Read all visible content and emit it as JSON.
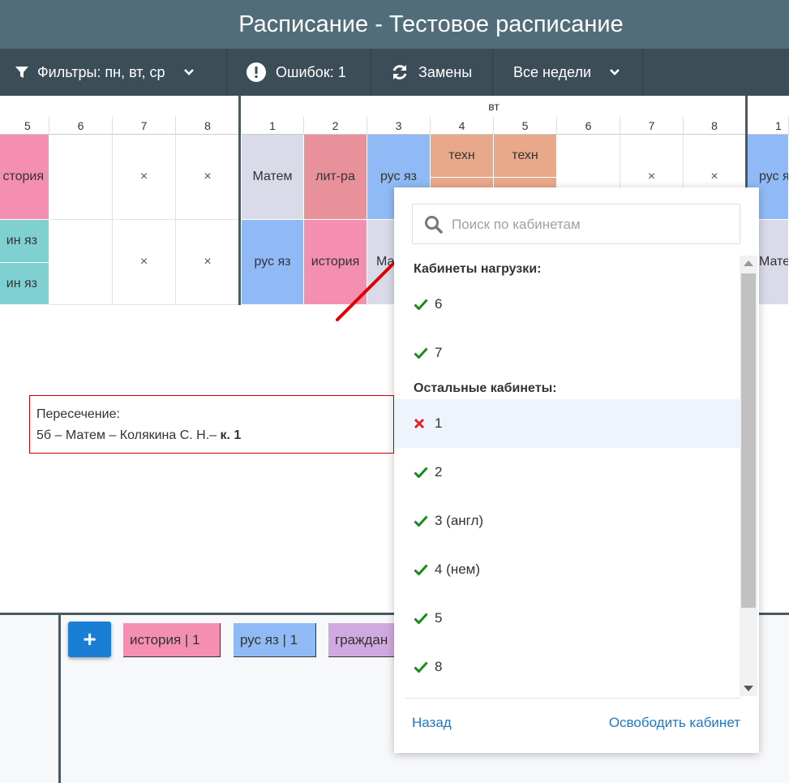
{
  "header": {
    "title": "Расписание - Тестовое расписание"
  },
  "toolbar": {
    "filters_label": "Фильтры: пн, вт, ср",
    "errors_label": "Ошибок: 1",
    "replacements_label": "Замены",
    "weeks_label": "Все недели"
  },
  "grid": {
    "day_label": "вт",
    "left_numbers": [
      "5",
      "6",
      "7",
      "8"
    ],
    "mid_numbers": [
      "1",
      "2",
      "3",
      "4",
      "5",
      "6",
      "7",
      "8"
    ],
    "right_numbers": [
      "1"
    ],
    "row1": {
      "c_left": "стория",
      "c1": "Матем",
      "c2": "лит-ра",
      "c3": "рус яз",
      "c4": "техн",
      "c5": "техн",
      "c_right": "рус яз"
    },
    "row2": {
      "c_left_top": "ин яз",
      "c_left_bottom": "ин яз",
      "c1": "рус яз",
      "c2": "история",
      "c3": "Ма",
      "c_right": "Мате"
    },
    "x_mark": "×",
    "colors": {
      "history": "#f48fb1",
      "russian": "#8fbaf5",
      "math": "#d9dbe8",
      "literature": "#e8919b",
      "tech": "#e8a98a",
      "english": "#7fd1d1",
      "civics": "#d0a9e0"
    }
  },
  "conflict": {
    "title": "Пересечение:",
    "detail": "5б – Матем – Колякина С. Н.–",
    "room": "к. 1"
  },
  "bottom": {
    "add_label": "+",
    "chips": [
      "история | 1",
      "рус яз | 1",
      "граждан"
    ]
  },
  "popup": {
    "search_placeholder": "Поиск по кабинетам",
    "load_section": "Кабинеты нагрузки:",
    "load_rooms": [
      "6",
      "7"
    ],
    "other_section": "Остальные кабинеты:",
    "other_rooms": [
      {
        "label": "1",
        "status": "conflict"
      },
      {
        "label": "2",
        "status": "ok"
      },
      {
        "label": "3 (англ)",
        "status": "ok"
      },
      {
        "label": "4 (нем)",
        "status": "ok"
      },
      {
        "label": "5",
        "status": "ok"
      },
      {
        "label": "8",
        "status": "ok"
      }
    ],
    "back_label": "Назад",
    "free_label": "Освободить кабинет"
  }
}
